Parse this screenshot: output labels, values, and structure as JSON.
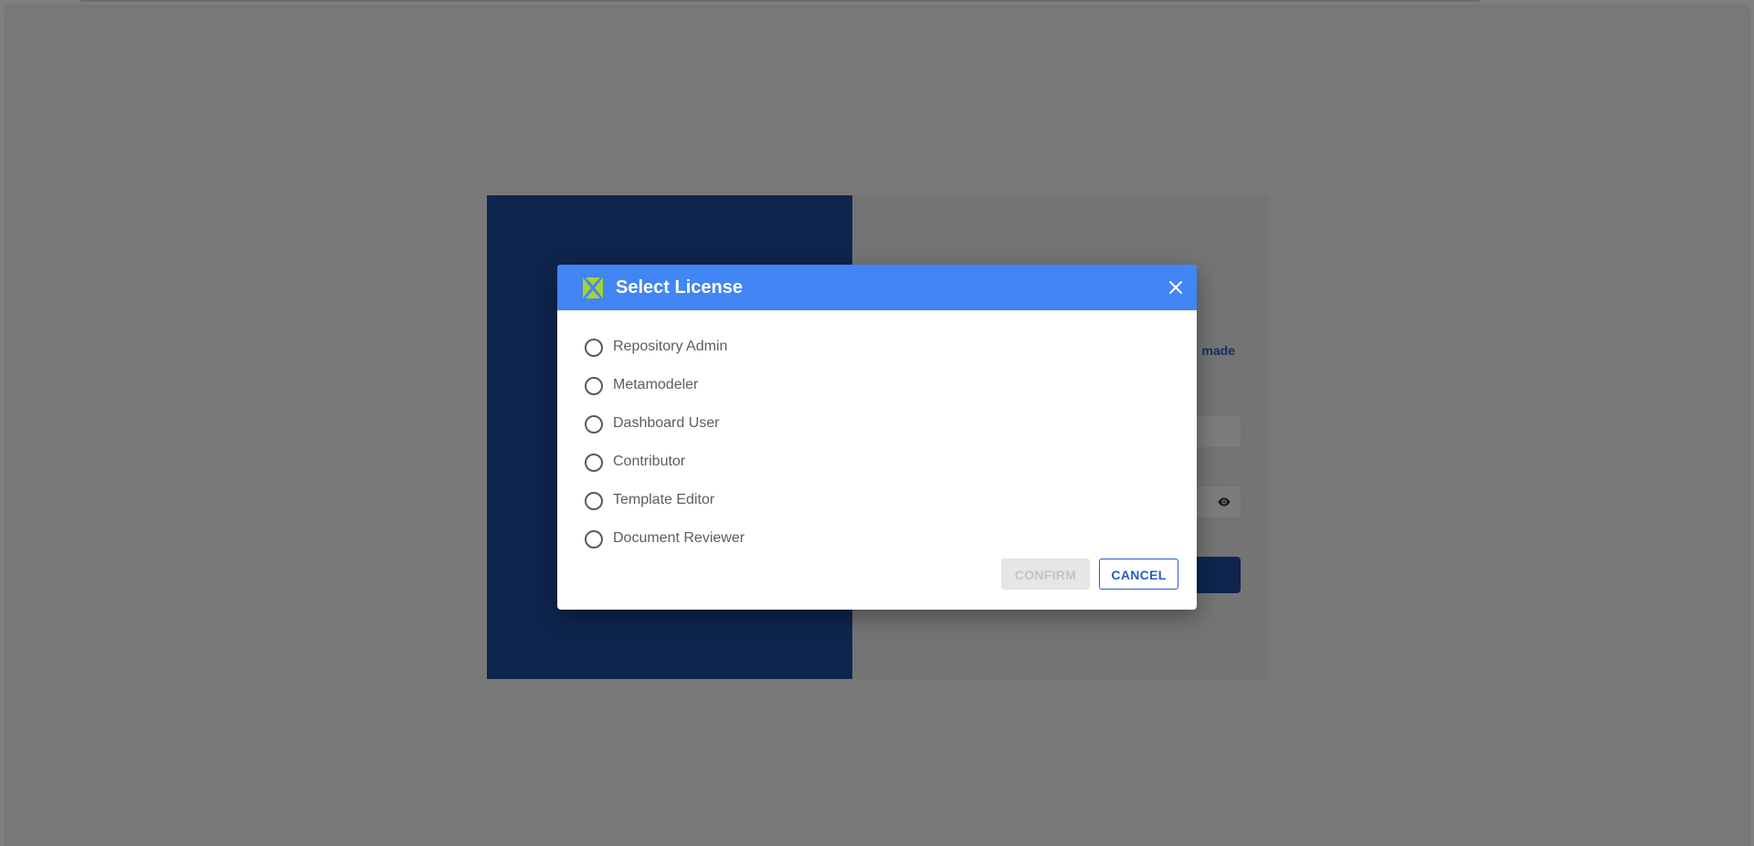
{
  "background_form": {
    "link_text_fragment": "made"
  },
  "dialog": {
    "title": "Select License",
    "logo_icon": "x-logo-icon",
    "close_icon": "close-icon",
    "options": [
      {
        "label": "Repository Admin",
        "selected": false
      },
      {
        "label": "Metamodeler",
        "selected": false
      },
      {
        "label": "Dashboard User",
        "selected": false
      },
      {
        "label": "Contributor",
        "selected": false
      },
      {
        "label": "Template Editor",
        "selected": false
      },
      {
        "label": "Document Reviewer",
        "selected": false
      }
    ],
    "confirm_label": "CONFIRM",
    "cancel_label": "CANCEL"
  },
  "colors": {
    "header_blue": "#4285f4",
    "brand_navy": "#1c4a9a",
    "logo_green": "#a4d233",
    "accent_blue": "#2a5cc4"
  }
}
